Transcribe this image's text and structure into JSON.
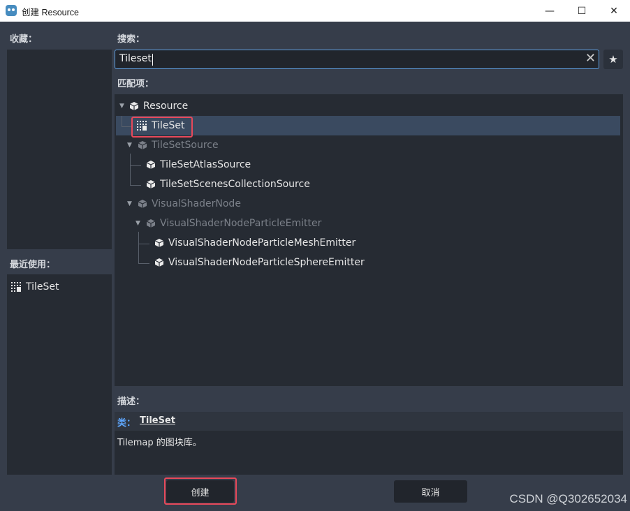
{
  "window": {
    "title": "创建 Resource",
    "minimize": "—",
    "maximize": "☐",
    "close": "✕"
  },
  "favorites": {
    "label": "收藏："
  },
  "recent": {
    "label": "最近使用：",
    "items": [
      {
        "label": "TileSet",
        "icon": "tileset-icon"
      }
    ]
  },
  "search": {
    "label": "搜索：",
    "value": "Tileset",
    "clear": "✕",
    "favorite": "★"
  },
  "matches": {
    "label": "匹配项：",
    "tree": [
      {
        "label": "Resource",
        "icon": "resource-cube-icon",
        "expanded": true,
        "dim": false
      },
      {
        "label": "TileSet",
        "icon": "tileset-icon",
        "selected": true,
        "dim": false
      },
      {
        "label": "TileSetSource",
        "icon": "resource-cube-icon",
        "expanded": true,
        "dim": true
      },
      {
        "label": "TileSetAtlasSource",
        "icon": "resource-cube-icon",
        "dim": false
      },
      {
        "label": "TileSetScenesCollectionSource",
        "icon": "resource-cube-icon",
        "dim": false
      },
      {
        "label": "VisualShaderNode",
        "icon": "resource-cube-icon",
        "expanded": true,
        "dim": true
      },
      {
        "label": "VisualShaderNodeParticleEmitter",
        "icon": "resource-cube-icon",
        "expanded": true,
        "dim": true
      },
      {
        "label": "VisualShaderNodeParticleMeshEmitter",
        "icon": "resource-cube-icon",
        "dim": false
      },
      {
        "label": "VisualShaderNodeParticleSphereEmitter",
        "icon": "resource-cube-icon",
        "dim": false
      }
    ]
  },
  "description": {
    "label": "描述：",
    "class_prefix": "类：",
    "class_name": "TileSet",
    "text": "Tilemap 的图块库。"
  },
  "buttons": {
    "create": "创建",
    "cancel": "取消"
  },
  "watermark": "CSDN @Q302652034",
  "colors": {
    "accent": "#5f9fe0",
    "highlight": "#e8495a",
    "selection": "#3a4a60",
    "class_prefix": "#5fa8ff"
  }
}
